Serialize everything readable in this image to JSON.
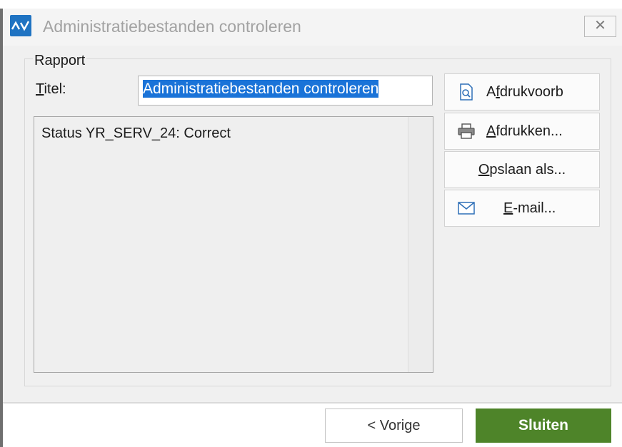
{
  "window": {
    "logo_text": "AV",
    "title": "Administratiebestanden controleren",
    "close_glyph": "✕",
    "close_icon": "close-icon"
  },
  "rapport": {
    "group_label": "Rapport",
    "title_label": "Titel:",
    "title_label_access_key": "T",
    "title_value": "Administratiebestanden controleren",
    "report_text": "Status YR_SERV_24: Correct"
  },
  "side_buttons": [
    {
      "label_pre": "A",
      "label_key": "f",
      "label_post": "drukvoorb",
      "icon": "print-preview-icon"
    },
    {
      "label_pre": "",
      "label_key": "A",
      "label_post": "fdrukken...",
      "icon": "printer-icon"
    },
    {
      "label_pre": "",
      "label_key": "O",
      "label_post": "pslaan als...",
      "icon": ""
    },
    {
      "label_pre": "",
      "label_key": "E",
      "label_post": "-mail...",
      "icon": "envelope-icon"
    }
  ],
  "footer": {
    "back_label": "< Vorige",
    "close_label": "Sluiten"
  },
  "colors": {
    "accent_blue": "#1f73c2",
    "selection": "#1a73d8",
    "primary_button": "#4e8429"
  }
}
